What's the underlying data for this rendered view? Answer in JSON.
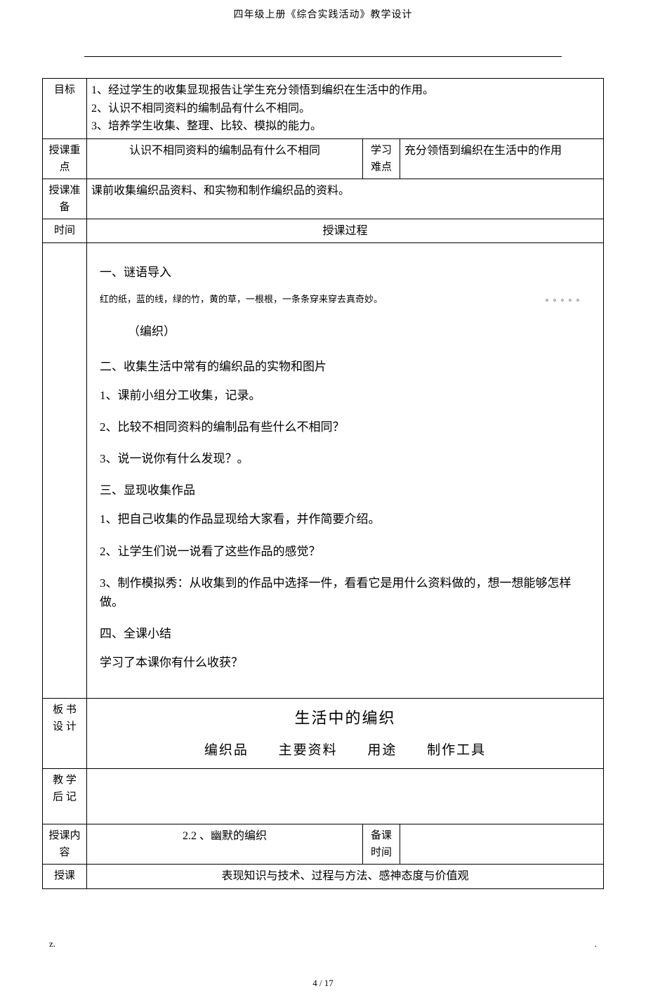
{
  "header": {
    "title": "四年级上册《综合实践活动》教学设计"
  },
  "rows": {
    "objectives_label": "目标",
    "objectives": {
      "line1": "1、经过学生的收集显现报告让学生充分领悟到编织在生活中的作用。",
      "line2": "2、认识不相同资料的编制品有什么不相同。",
      "line3": "3、培养学生收集、整理、比较、模拟的能力。"
    },
    "teach_focus_label": "授课重点",
    "teach_focus": "认识不相同资料的编制品有什么不相同",
    "learn_diff_label": "学习难点",
    "learn_diff": "充分领悟到编织在生活中的作用",
    "prep_label": "授课准备",
    "prep": "课前收集编织品资料、和实物和制作编织品的资料。",
    "time_label": "时间",
    "process_header": "授课过程"
  },
  "process": {
    "s1_title": "一、谜语导入",
    "riddle": "红的纸，蓝的线，绿的竹，黄的草，一根根，一条条穿来穿去真奇妙。",
    "riddle_dots": "。。。。。",
    "answer": "（编织）",
    "s2_title": "二、收集生活中常有的编织品的实物和图片",
    "s2_i1": "1、课前小组分工收集，记录。",
    "s2_i2": "2、比较不相同资料的编制品有些什么不相同？",
    "s2_i3": "3、说一说你有什么发现？。",
    "s3_title": "三、显现收集作品",
    "s3_i1": "1、把自己收集的作品显现给大家看，并作简要介绍。",
    "s3_i2": "2、让学生们说一说看了这些作品的感觉？",
    "s3_i3": "3、制作模拟秀：从收集到的作品中选择一件，看看它是用什么资料做的，想一想能够怎样做。",
    "s4_title": "四、全课小结",
    "s4_i1": "学习了本课你有什么收获？"
  },
  "board": {
    "label_chars": [
      "板",
      "书",
      "设",
      "计"
    ],
    "title": "生活中的编织",
    "col1": "编织品",
    "col2": "主要资料",
    "col3": "用途",
    "col4": "制作工具"
  },
  "postnote": {
    "label_chars": [
      "教",
      "学",
      "后",
      "记"
    ]
  },
  "next": {
    "content_label": "授课内容",
    "content": "2.2 、幽默的编织",
    "prep_time_label1": "备课",
    "prep_time_label2": "时间",
    "next_label": "授课",
    "next_body": "表现知识与技术、过程与方法、感神态度与价值观"
  },
  "footer": {
    "left": "z.",
    "right": ".",
    "pagenum": "4 / 17"
  }
}
